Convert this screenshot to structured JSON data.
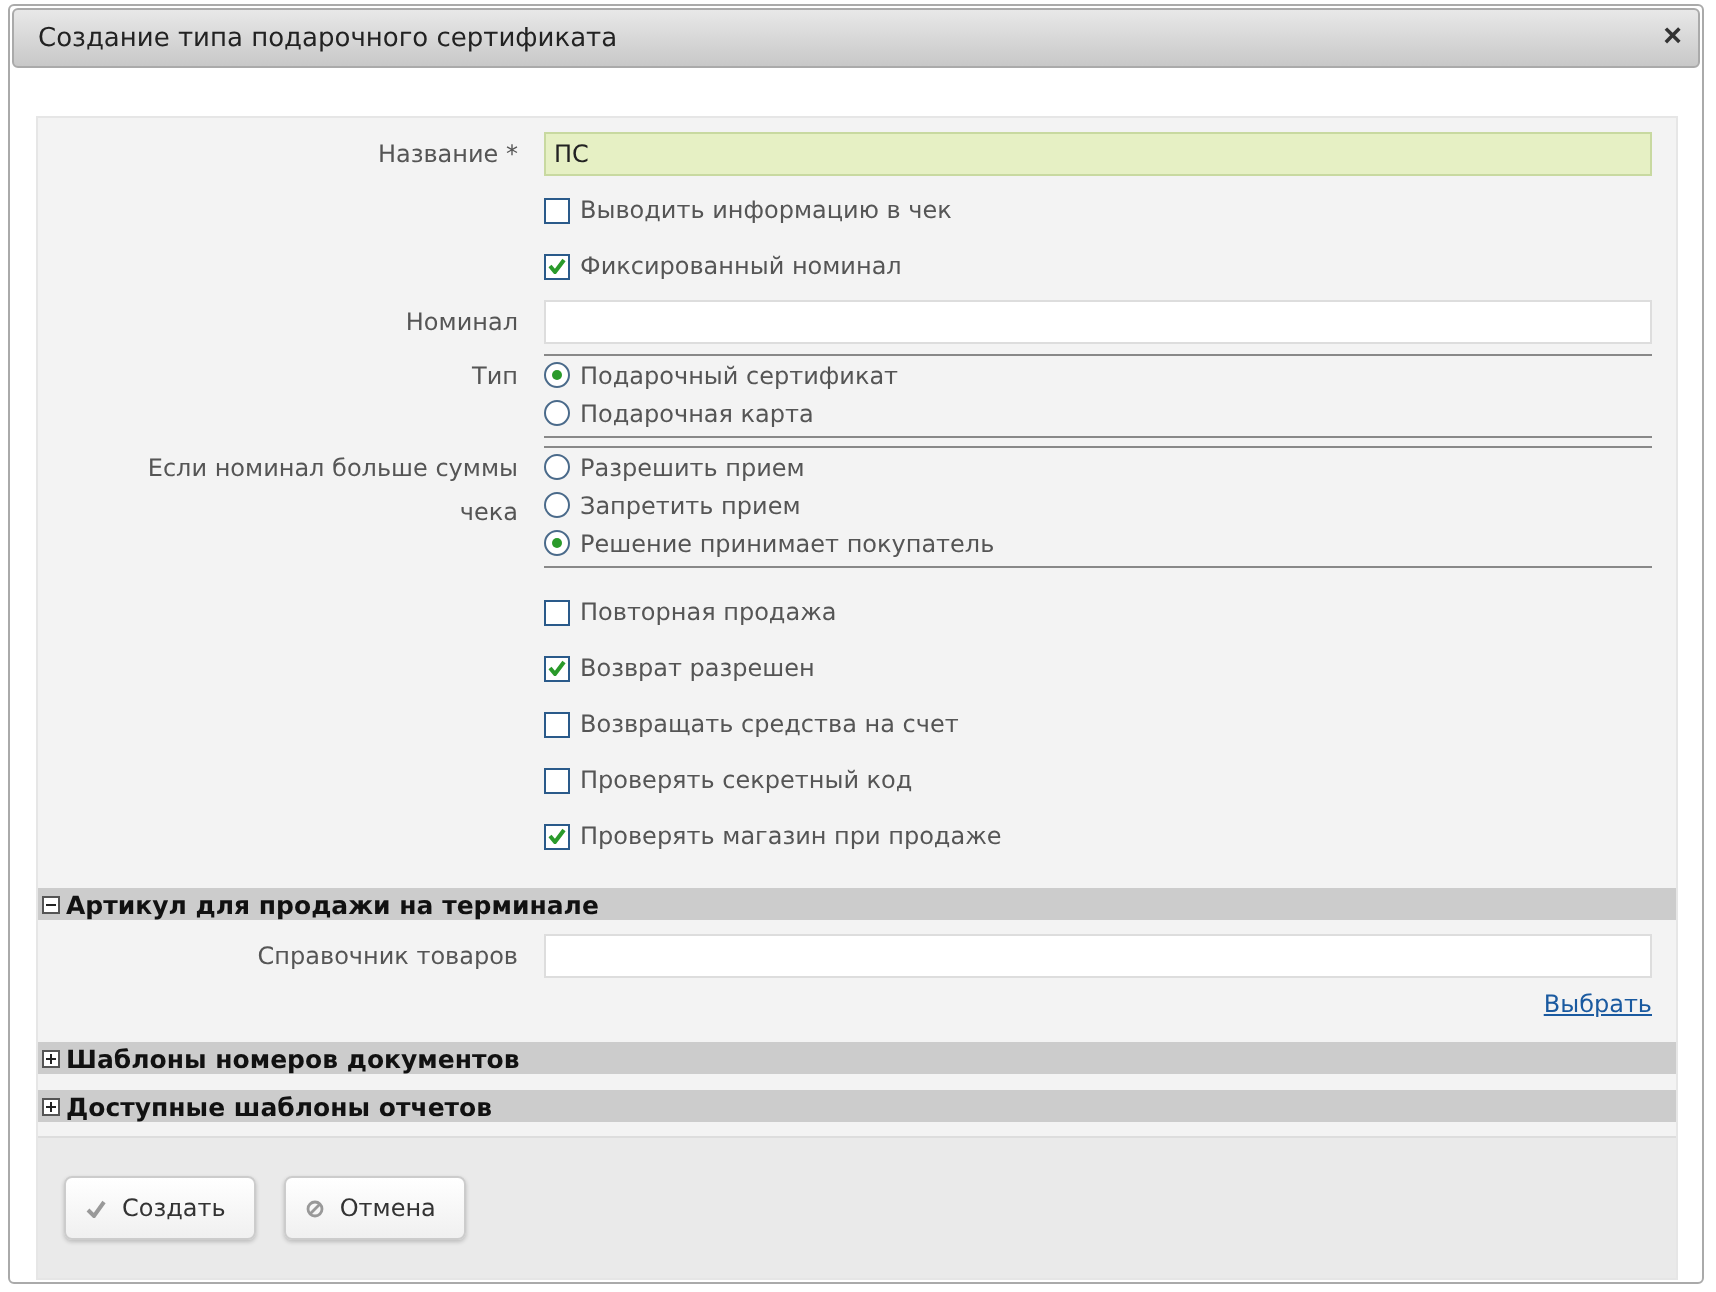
{
  "window": {
    "title": "Создание типа подарочного сертификата",
    "close": "×"
  },
  "fields": [
    {
      "kind": "text",
      "label": "Название *",
      "value": "ПС",
      "required": true
    },
    {
      "kind": "checkbox",
      "text": "Выводить информацию в чек",
      "checked": false
    },
    {
      "kind": "checkbox",
      "text": "Фиксированный номинал",
      "checked": true
    },
    {
      "kind": "text",
      "label": "Номинал",
      "required": false
    },
    {
      "kind": "radio",
      "label": "Тип",
      "options": [
        {
          "text": "Подарочный сертификат",
          "selected": true
        },
        {
          "text": "Подарочная карта",
          "selected": false
        }
      ]
    },
    {
      "kind": "radio",
      "label": "Если номинал больше суммы чека",
      "options": [
        {
          "text": "Разрешить прием",
          "selected": false
        },
        {
          "text": "Запретить прием",
          "selected": false
        },
        {
          "text": "Решение принимает покупатель",
          "selected": true
        }
      ]
    },
    {
      "kind": "checkbox",
      "text": "Повторная продажа",
      "checked": false
    },
    {
      "kind": "checkbox",
      "text": "Возврат разрешен",
      "checked": true
    },
    {
      "kind": "checkbox",
      "text": "Возвращать средства на счет",
      "checked": false
    },
    {
      "kind": "checkbox",
      "text": "Проверять секретный код",
      "checked": false
    },
    {
      "kind": "checkbox",
      "text": "Проверять магазин при продаже",
      "checked": true
    }
  ],
  "sections": [
    {
      "title": "Артикул для продажи на терминале",
      "expanded": true,
      "field": {
        "label": "Справочник товаров",
        "link": "Выбрать"
      }
    },
    {
      "title": "Шаблоны номеров документов",
      "expanded": false
    },
    {
      "title": "Доступные шаблоны отчетов",
      "expanded": false
    }
  ],
  "buttons": [
    {
      "kind": "ok",
      "label": "Создать"
    },
    {
      "kind": "cancel",
      "label": "Отмена"
    }
  ]
}
